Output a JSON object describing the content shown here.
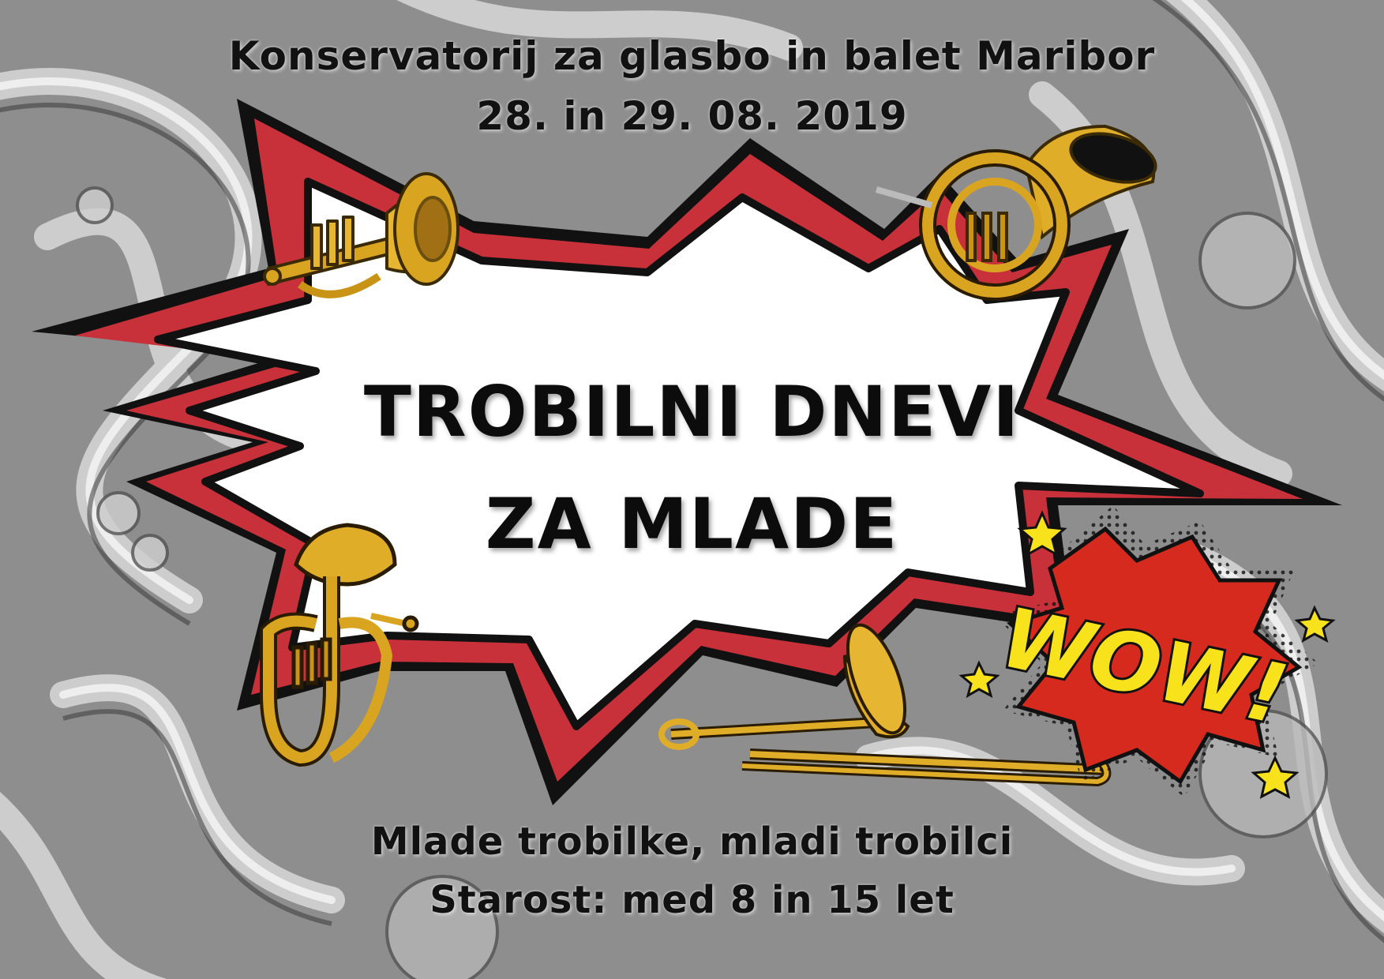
{
  "poster": {
    "header_line1": "Konservatorij za glasbo in balet Maribor",
    "header_line2": "28. in 29. 08. 2019",
    "title_line1": "TROBILNI DNEVI",
    "title_line2": "ZA MLADE",
    "footer_line1": "Mlade trobilke, mladi trobilci",
    "footer_line2": "Starost: med 8 in 15 let",
    "burst_text": "WOW!"
  },
  "colors": {
    "background": "#8f8f8f",
    "burst_fill": "#ffffff",
    "burst_ribbon": "#c8313a",
    "burst_outline": "#111111",
    "brass": "#d9a520",
    "wow_red": "#d62a1e",
    "wow_yellow": "#f7e21c"
  },
  "icons": [
    "trumpet-icon",
    "french-horn-icon",
    "euphonium-icon",
    "trombone-icon",
    "star-icon"
  ]
}
